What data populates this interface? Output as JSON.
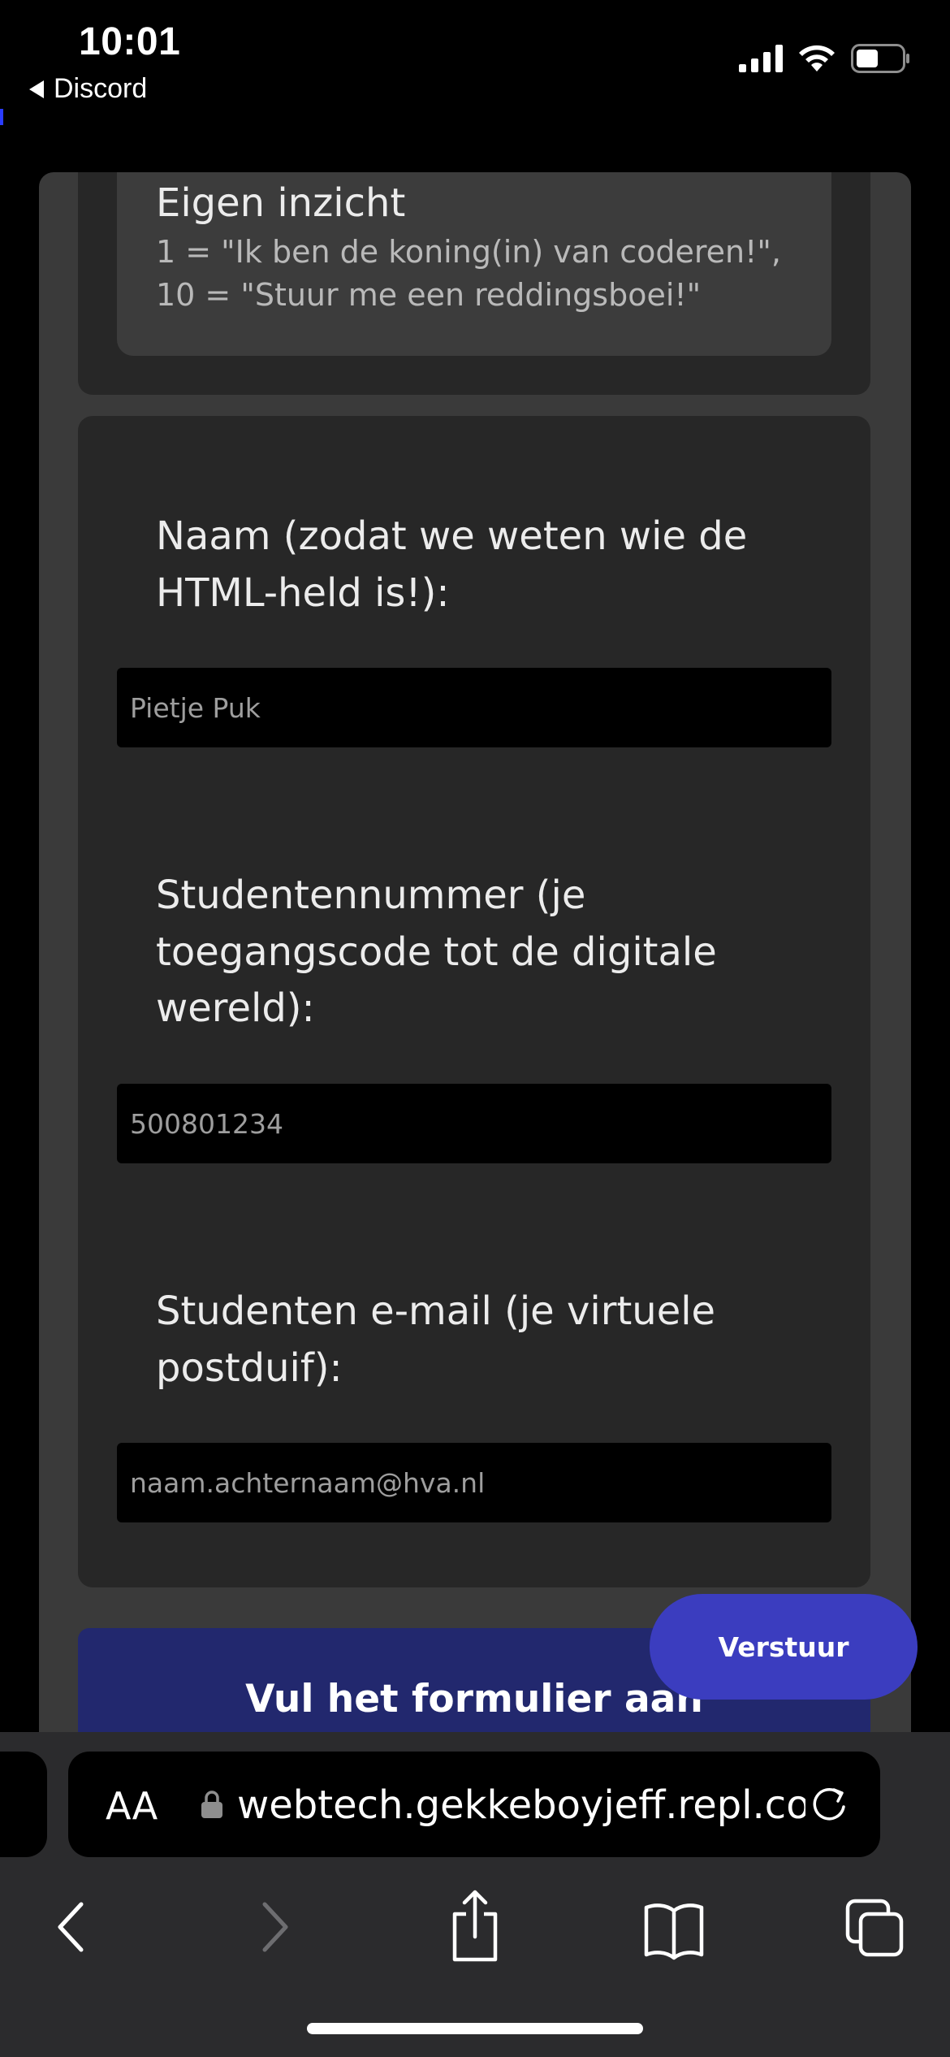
{
  "status_bar": {
    "time": "10:01",
    "back_app": "Discord",
    "icons": [
      "signal-icon",
      "wifi-icon",
      "battery-icon"
    ]
  },
  "form": {
    "eigen_inzicht": {
      "title": "Eigen inzicht",
      "description": "1 = \"Ik ben de koning(in) van coderen!\", 10 = \"Stuur me een reddingsboei!\""
    },
    "fields": [
      {
        "label": "Naam (zodat we weten wie de HTML-held is!):",
        "placeholder": "Pietje Puk"
      },
      {
        "label": "Studentennummer (je toegangscode tot de digitale wereld):",
        "placeholder": "500801234"
      },
      {
        "label": "Studenten e-mail (je virtuele postduif):",
        "placeholder": "naam.achternaam@hva.nl"
      }
    ],
    "banner": "Vul het formulier aan",
    "submit_label": "Verstuur"
  },
  "browser": {
    "aa_label": "AA",
    "url": "webtech.gekkeboyjeff.repl.co"
  },
  "colors": {
    "page_bg": "#3a3a3a",
    "card_bg": "#272727",
    "banner_bg": "#22286e",
    "submit_bg": "#3b3dbf"
  }
}
